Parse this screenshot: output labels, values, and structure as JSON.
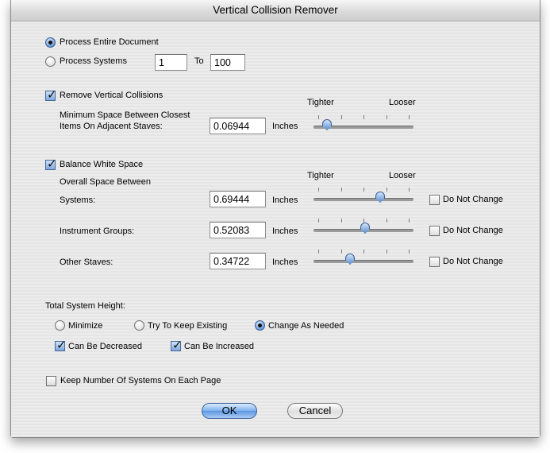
{
  "window": {
    "title": "Vertical Collision Remover"
  },
  "scope": {
    "process_entire_label": "Process Entire Document",
    "process_systems_label": "Process Systems",
    "from_value": "1",
    "to_label": "To",
    "to_value": "100",
    "selected": "entire"
  },
  "vertical": {
    "remove_label": "Remove Vertical Collisions",
    "remove_checked": true,
    "min_space_line1": "Minimum Space Between Closest",
    "min_space_line2": "Items On Adjacent Staves:",
    "min_space_value": "0.06944",
    "units": "Inches",
    "tighter": "Tighter",
    "looser": "Looser",
    "slider_level": 0.1
  },
  "balance": {
    "label": "Balance White Space",
    "checked": true,
    "overall_label": "Overall Space Between",
    "tighter": "Tighter",
    "looser": "Looser",
    "rows": [
      {
        "label": "Systems:",
        "value": "0.69444",
        "units": "Inches",
        "dnc_label": "Do Not Change",
        "dnc_checked": false,
        "slider_level": 0.68
      },
      {
        "label": "Instrument Groups:",
        "value": "0.52083",
        "units": "Inches",
        "dnc_label": "Do Not Change",
        "dnc_checked": false,
        "slider_level": 0.52
      },
      {
        "label": "Other Staves:",
        "value": "0.34722",
        "units": "Inches",
        "dnc_label": "Do Not Change",
        "dnc_checked": false,
        "slider_level": 0.35
      }
    ]
  },
  "height": {
    "label": "Total System Height:",
    "options": [
      "Minimize",
      "Try To Keep Existing",
      "Change As Needed"
    ],
    "selected": "Change As Needed",
    "can_decrease_label": "Can Be Decreased",
    "can_decrease_checked": true,
    "can_increase_label": "Can Be Increased",
    "can_increase_checked": true
  },
  "keep_systems": {
    "label": "Keep Number Of Systems On Each Page",
    "checked": false
  },
  "buttons": {
    "ok": "OK",
    "cancel": "Cancel"
  }
}
